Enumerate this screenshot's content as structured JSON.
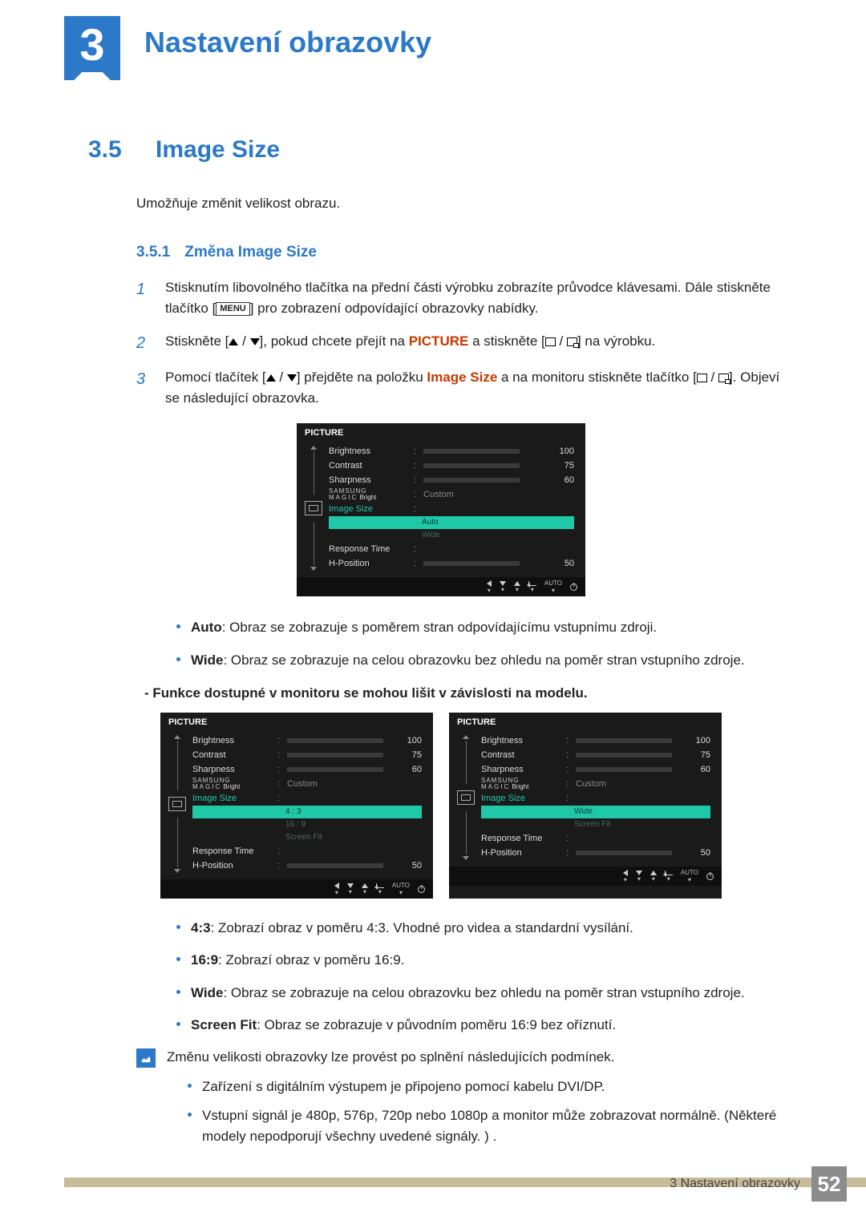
{
  "chapter": {
    "number": "3",
    "title": "Nastavení obrazovky"
  },
  "section": {
    "number": "3.5",
    "title": "Image Size",
    "intro": "Umožňuje změnit velikost obrazu."
  },
  "subsection": {
    "number": "3.5.1",
    "title": "Změna Image Size"
  },
  "steps": {
    "s1n": "1",
    "s1a": "Stisknutím libovolného tlačítka na přední části výrobku zobrazíte průvodce klávesami. Dále stiskněte tlačítko [",
    "s1menu": "MENU",
    "s1b": "] pro zobrazení odpovídající obrazovky nabídky.",
    "s2n": "2",
    "s2a": "Stiskněte [",
    "s2b": "], pokud chcete přejít na ",
    "s2kw": "PICTURE",
    "s2c": " a stiskněte [",
    "s2d": "] na výrobku.",
    "s3n": "3",
    "s3a": "Pomocí tlačítek [",
    "s3b": "] přejděte na položku ",
    "s3kw": "Image Size",
    "s3c": " a na monitoru stiskněte tlačítko [",
    "s3d": "]. Objeví se následující obrazovka."
  },
  "osd": {
    "title": "PICTURE",
    "rows": {
      "brightness": "Brightness",
      "contrast": "Contrast",
      "sharpness": "Sharpness",
      "magic1": "SAMSUNG",
      "magic2": "MAGIC",
      "magic3": " Bright",
      "image_size": "Image Size",
      "response": "Response Time",
      "hpos": "H-Position",
      "custom": "Custom"
    },
    "vals": {
      "brightness": "100",
      "contrast": "75",
      "sharpness": "60",
      "hpos": "50"
    },
    "opts_a": {
      "o1": "Auto",
      "o2": "Wide"
    },
    "opts_b": {
      "o1": "4 : 3",
      "o2": "16 : 9",
      "o3": "Screen Fit"
    },
    "opts_c": {
      "o1": "Wide",
      "o2": "Screen Fit"
    },
    "foot_auto": "AUTO"
  },
  "bullets1": {
    "b1k": "Auto",
    "b1t": ": Obraz se zobrazuje s poměrem stran odpovídajícímu vstupnímu zdroji.",
    "b2k": "Wide",
    "b2t": ": Obraz se zobrazuje na celou obrazovku bez ohledu na poměr stran vstupního zdroje."
  },
  "note_bold": "- Funkce dostupné v monitoru se mohou lišit v závislosti na modelu.",
  "bullets2": {
    "b1k": "4:3",
    "b1t": ": Zobrazí obraz v poměru 4:3. Vhodné pro videa a standardní vysílání.",
    "b2k": "16:9",
    "b2t": ": Zobrazí obraz v poměru 16:9.",
    "b3k": "Wide",
    "b3t": ": Obraz se zobrazuje na celou obrazovku bez ohledu na poměr stran vstupního zdroje.",
    "b4k": "Screen Fit",
    "b4t": ": Obraz se zobrazuje v původním poměru 16:9 bez oříznutí."
  },
  "note": {
    "lead": "Změnu velikosti obrazovky lze provést po splnění následujících podmínek.",
    "i1": "Zařízení s digitálním výstupem je připojeno pomocí kabelu DVI/DP.",
    "i2": "Vstupní signál je 480p, 576p, 720p nebo 1080p a monitor může zobrazovat normálně. (Některé modely nepodporují všechny uvedené signály. ) ."
  },
  "footer": {
    "text": "3 Nastavení obrazovky",
    "page": "52"
  }
}
